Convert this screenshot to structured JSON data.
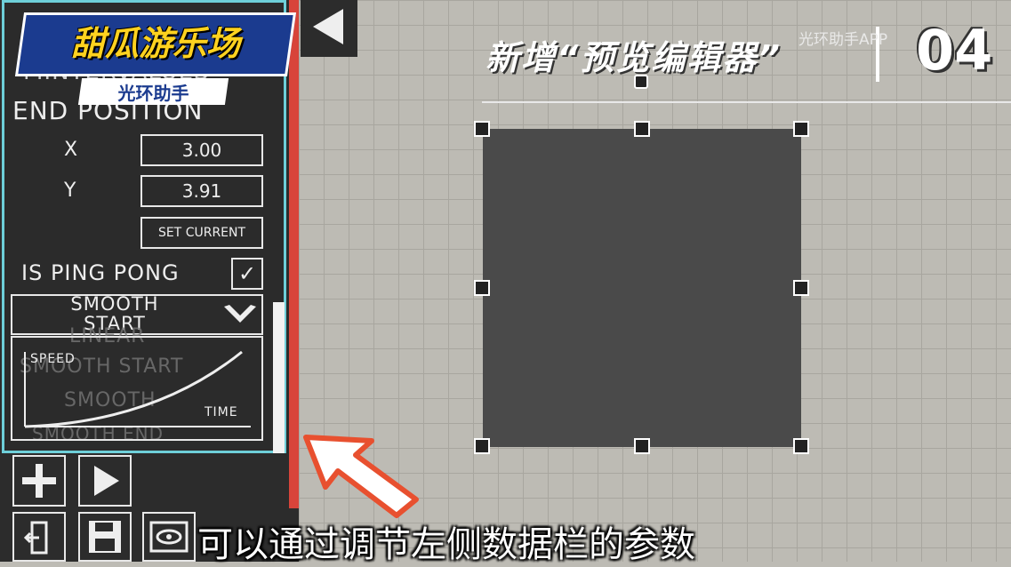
{
  "banner": {
    "title": "甜瓜游乐场",
    "subtitle": "光环助手"
  },
  "panel": {
    "partial_heading": "MINTERVALUES",
    "section": "END POSITION",
    "x_label": "X",
    "x_value": "3.00",
    "y_label": "Y",
    "y_value": "3.91",
    "set_current": "SET CURRENT",
    "ping_pong_label": "IS PING PONG",
    "ping_pong_checked": "✓",
    "dropdown_selected": "SMOOTH\nSTART",
    "dropdown_options": [
      "LINEAR",
      "SMOOTH START",
      "SMOOTH",
      "SMOOTH END"
    ],
    "graph_y_label": "SPEED",
    "graph_x_label": "TIME"
  },
  "header": {
    "title": "新增“预览编辑器”",
    "number": "04",
    "watermark": "光环助手APP"
  },
  "caption": "可以通过调节左侧数据栏的参数",
  "colors": {
    "panel_bg": "#2c2c2c",
    "accent_cyan": "#6ecfd9",
    "accent_red": "#d8443a",
    "grid_bg": "#bdbbb4",
    "square": "#4a4a4a",
    "banner_blue": "#1b3b8f",
    "banner_yellow": "#ffd21f"
  },
  "icons": [
    "arrow-left-icon",
    "plus-icon",
    "play-icon",
    "exit-icon",
    "save-icon",
    "preview-icon",
    "checkbox-check-icon",
    "chevron-down-icon",
    "pointer-arrow-icon"
  ]
}
